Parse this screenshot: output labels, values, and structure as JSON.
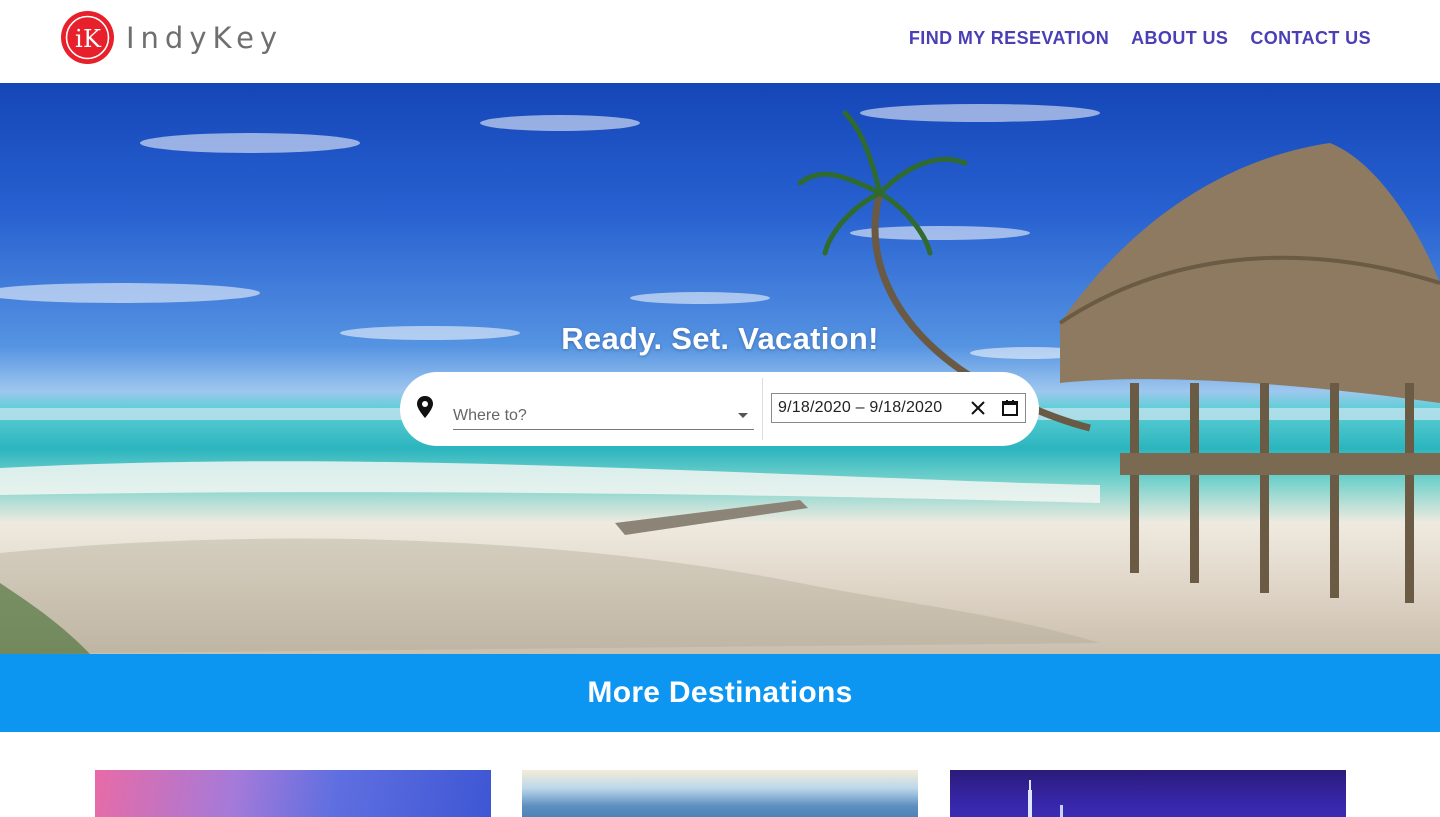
{
  "header": {
    "logo": {
      "mark_letter": "iK",
      "brand_text": "IndyKey"
    },
    "nav": [
      {
        "label": "FIND MY RESEVATION"
      },
      {
        "label": "ABOUT US"
      },
      {
        "label": "CONTACT US"
      }
    ]
  },
  "hero": {
    "title": "Ready. Set. Vacation!",
    "search": {
      "location_placeholder": "Where to?",
      "date_range": "9/18/2020 – 9/18/2020",
      "icons": {
        "location": "map-pin-icon",
        "dropdown": "caret-down-icon",
        "clear": "close-icon",
        "calendar": "calendar-icon"
      }
    }
  },
  "destinations": {
    "title": "More Destinations"
  },
  "colors": {
    "brand_red": "#e8202b",
    "nav_text": "#4a3fb5",
    "band_blue": "#0d95f2"
  }
}
